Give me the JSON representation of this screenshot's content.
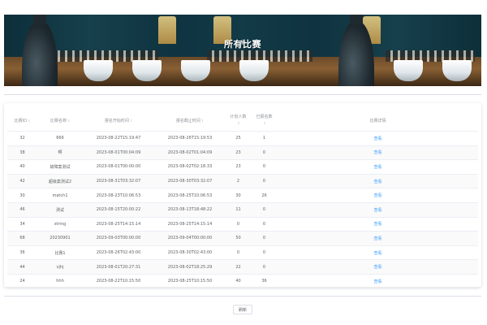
{
  "banner": {
    "title": "所有比赛"
  },
  "table": {
    "headers": {
      "id": "比赛ID",
      "name": "比赛名称",
      "start": "报名开始时间",
      "end": "报名截止时间",
      "planned": [
        "计划人数",
        ""
      ],
      "registered": [
        "已报名数",
        ""
      ],
      "detail": "比赛详情"
    },
    "sort_icon": "⇕",
    "rows": [
      {
        "id": "32",
        "name": "666",
        "start": "2023-08-22T15:19:47",
        "end": "2023-08-26T15:19:53",
        "planned": "25",
        "registered": "1",
        "detail": "查看"
      },
      {
        "id": "38",
        "name": "啊",
        "start": "2023-08-01T00:04:09",
        "end": "2023-08-02T01:04:09",
        "planned": "23",
        "registered": "0",
        "detail": "查看"
      },
      {
        "id": "40",
        "name": "故障案测试",
        "start": "2023-08-01T00:00:00",
        "end": "2023-08-02T02:18:33",
        "planned": "23",
        "registered": "0",
        "detail": "查看"
      },
      {
        "id": "42",
        "name": "超级案测试2",
        "start": "2023-08-31T03:32:07",
        "end": "2023-08-30T03:32:07",
        "planned": "2",
        "registered": "0",
        "detail": "查看"
      },
      {
        "id": "30",
        "name": "match1",
        "start": "2023-08-23T10:06:53",
        "end": "2023-08-25T10:06:53",
        "planned": "30",
        "registered": "26",
        "detail": "查看"
      },
      {
        "id": "46",
        "name": "测试",
        "start": "2023-08-15T20:00:22",
        "end": "2023-08-13T18:48:22",
        "planned": "11",
        "registered": "0",
        "detail": "查看"
      },
      {
        "id": "34",
        "name": "string",
        "start": "2023-08-25T14:15:14",
        "end": "2023-08-25T14:15:14",
        "planned": "0",
        "registered": "0",
        "detail": "查看"
      },
      {
        "id": "68",
        "name": "20230901",
        "start": "2023-09-03T00:00:00",
        "end": "2023-09-04T00:00:00",
        "planned": "50",
        "registered": "0",
        "detail": "查看"
      },
      {
        "id": "36",
        "name": "比赛1",
        "start": "2023-08-26T02:43:00",
        "end": "2023-08-30T02:43:00",
        "planned": "0",
        "registered": "0",
        "detail": "查看"
      },
      {
        "id": "44",
        "name": "vjhj",
        "start": "2023-08-01T20:27:31",
        "end": "2023-08-02T18:25:29",
        "planned": "22",
        "registered": "0",
        "detail": "查看"
      },
      {
        "id": "24",
        "name": "hhh",
        "start": "2023-08-22T10:15:50",
        "end": "2023-08-25T10:15:50",
        "planned": "40",
        "registered": "36",
        "detail": "查看"
      }
    ]
  },
  "refresh_label": "刷新",
  "colors": {
    "link": "#409eff",
    "text": "#606266",
    "header": "#909399",
    "border": "#ebeef5"
  }
}
